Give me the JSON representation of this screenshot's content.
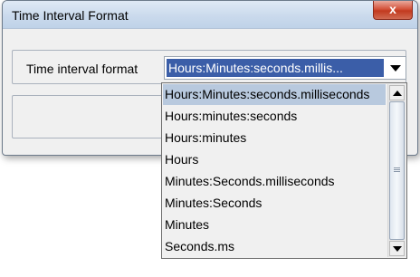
{
  "window": {
    "title": "Time Interval Format",
    "close_label": "x"
  },
  "form": {
    "label": "Time interval format",
    "selected_value": "Hours:Minutes:seconds.millis..."
  },
  "dropdown": {
    "items": [
      "Hours:Minutes:seconds.milliseconds",
      "Hours:minutes:seconds",
      "Hours:minutes",
      "Hours",
      "Minutes:Seconds.milliseconds",
      "Minutes:Seconds",
      "Minutes",
      "Seconds.ms"
    ],
    "highlighted_index": 0
  },
  "icons": {
    "close": "close-icon",
    "combo_arrow": "chevron-down-icon",
    "scroll_up": "scroll-up-icon",
    "scroll_down": "scroll-down-icon"
  },
  "colors": {
    "selection": "#3b5ea8",
    "list_highlight": "#b8c9de",
    "close_button": "#c23a1f"
  }
}
